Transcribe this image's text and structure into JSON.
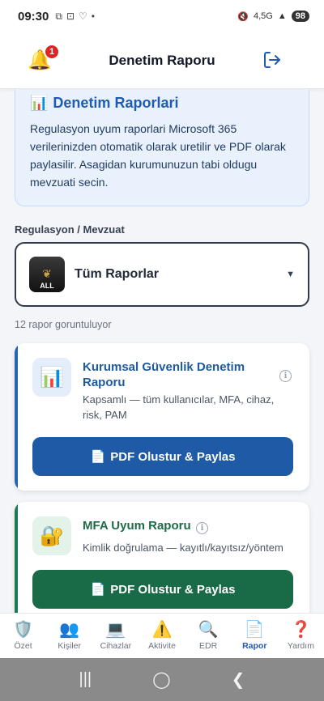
{
  "status_bar": {
    "time": "09:30",
    "notif_icons": [
      "⧉",
      "⊡",
      "♡",
      "•"
    ],
    "network": "4,5G",
    "battery": "98"
  },
  "header": {
    "title": "Denetim Raporu",
    "notification_count": "1"
  },
  "info": {
    "title": "Denetim Raporlari",
    "text": "Regulasyon uyum raporlari Microsoft 365 verilerinizden otomatik olarak uretilir ve PDF olarak paylasilir. Asagidan kurumunuzun tabi oldugu mevzuati secin."
  },
  "regulation": {
    "label": "Regulasyon / Mevzuat",
    "selected": "Tüm Raporlar",
    "logo_text": "ALL"
  },
  "count_text": "12 rapor goruntuluyor",
  "reports": [
    {
      "title": "Kurumsal Güvenlik Denetim Raporu",
      "description": "Kapsamlı — tüm kullanıcılar, MFA, cihaz, risk, PAM",
      "button": "PDF Olustur & Paylas",
      "color": "#1f5aa6",
      "icon": "bar-chart-icon"
    },
    {
      "title": "MFA Uyum Raporu",
      "description": "Kimlik doğrulama — kayıtlı/kayıtsız/yöntem",
      "button": "PDF Olustur & Paylas",
      "color": "#196b47",
      "icon": "lock-icon"
    }
  ],
  "nav": {
    "items": [
      {
        "label": "Özet",
        "icon": "shield-icon"
      },
      {
        "label": "Kişiler",
        "icon": "users-icon"
      },
      {
        "label": "Cihazlar",
        "icon": "laptop-icon"
      },
      {
        "label": "Aktivite",
        "icon": "warning-icon"
      },
      {
        "label": "EDR",
        "icon": "search-icon"
      },
      {
        "label": "Rapor",
        "icon": "report-icon"
      },
      {
        "label": "Yardım",
        "icon": "question-icon"
      }
    ],
    "active": "Rapor"
  },
  "colors": {
    "accent": "#1e5bb3",
    "danger": "#dc2626",
    "green": "#196b47"
  }
}
